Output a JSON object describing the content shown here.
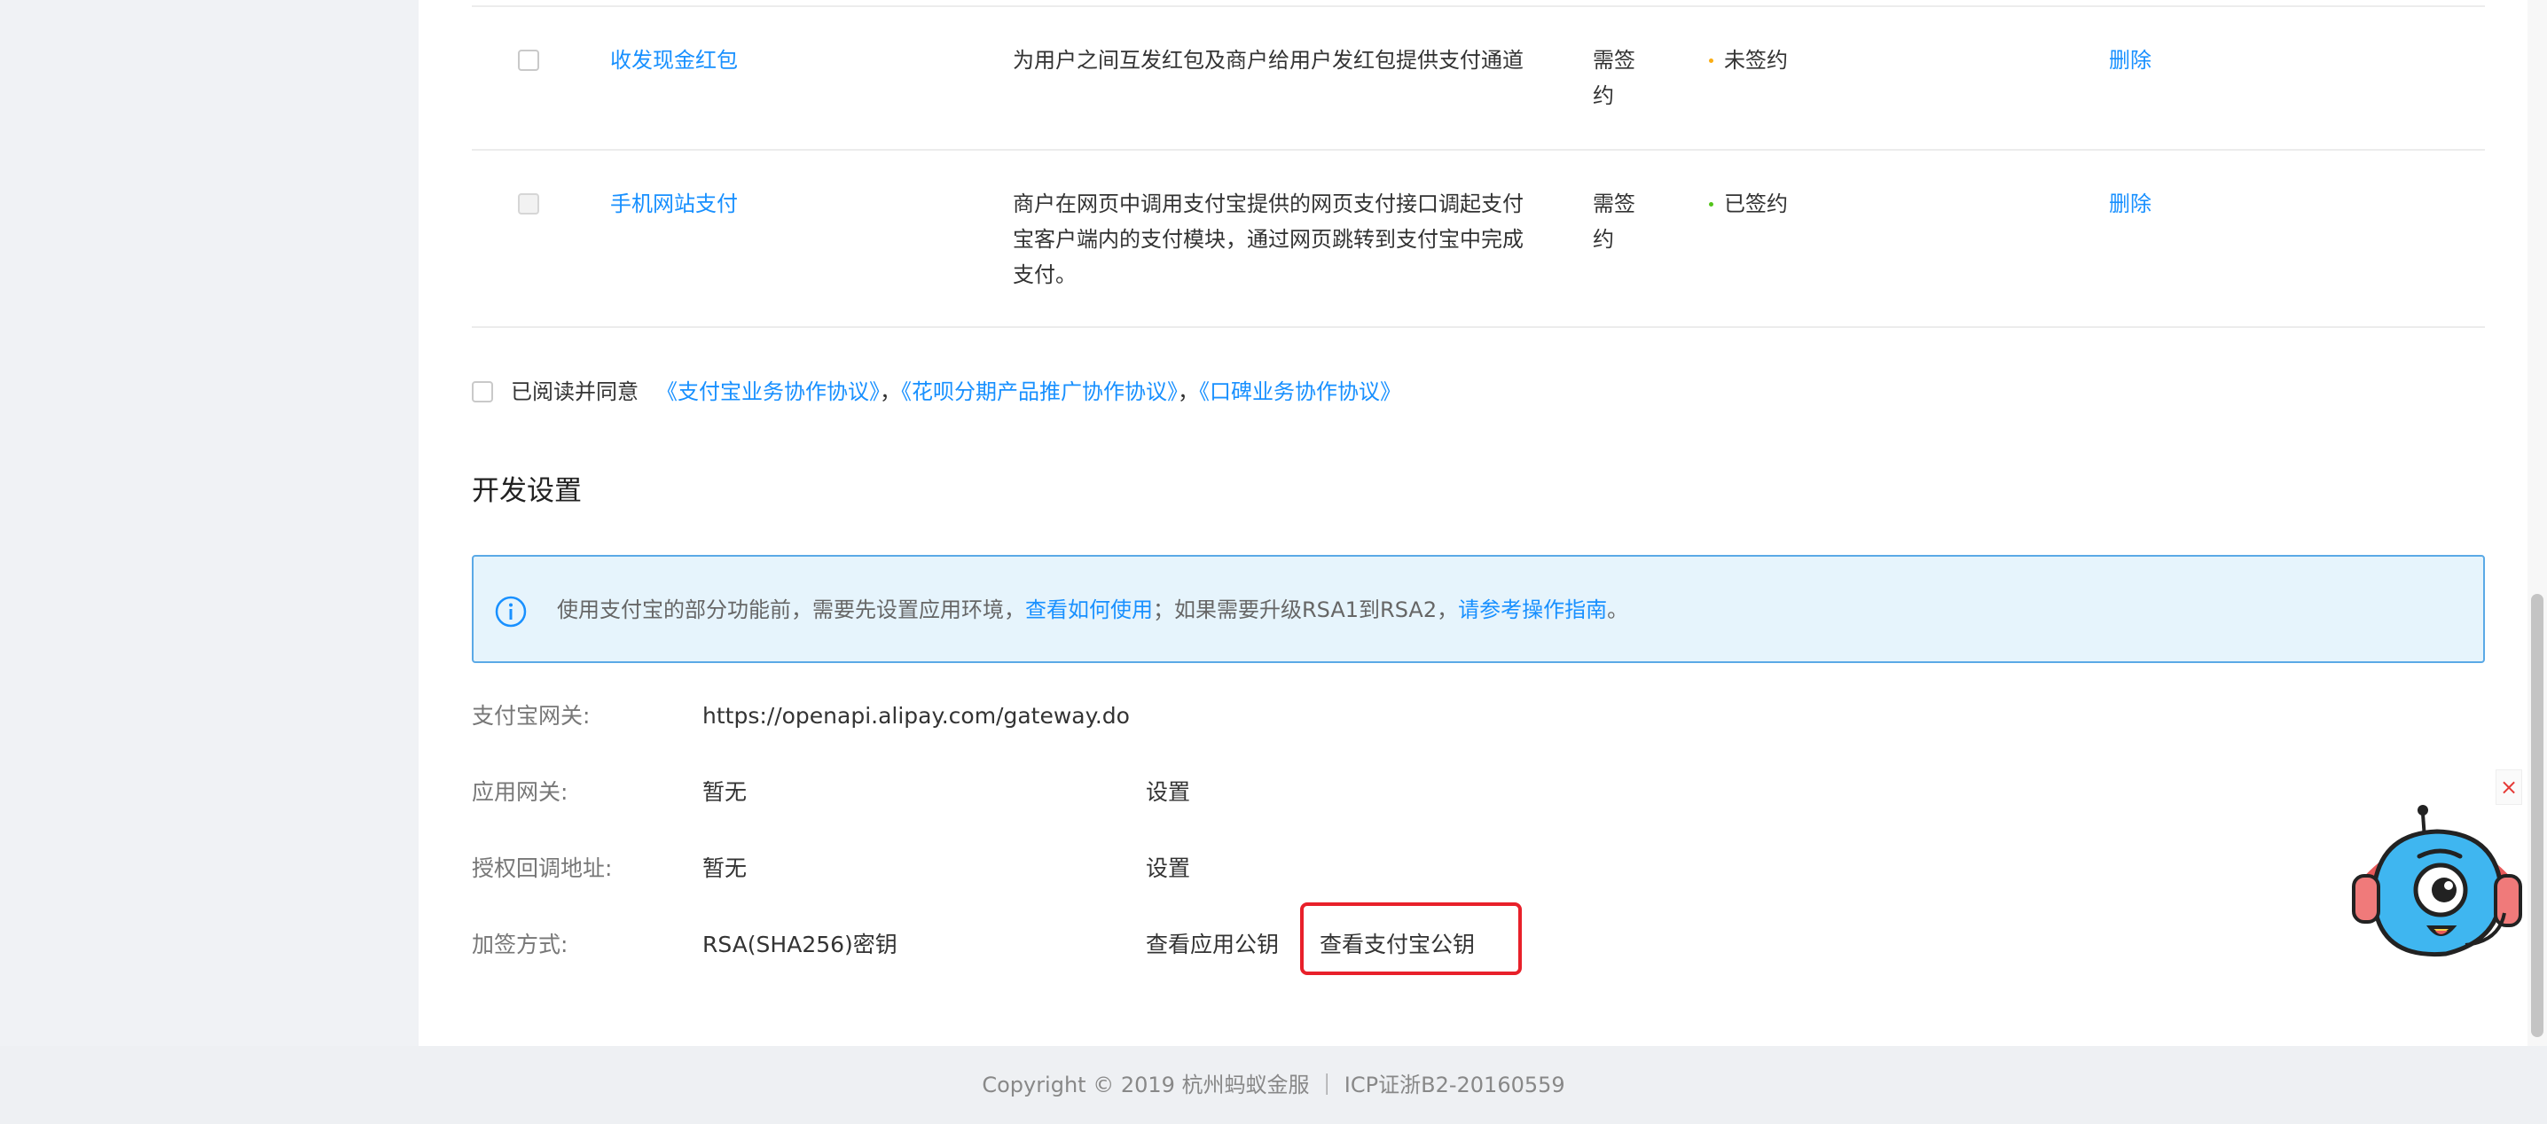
{
  "products": {
    "rows": [
      {
        "name": "收发现金红包",
        "desc_lines": [
          "为用户之间互发红包及商户给用户发红包提供支付通道"
        ],
        "sign_req_lines": [
          "需签",
          "约"
        ],
        "status": "未签约",
        "status_color": "#faad14",
        "action": "删除"
      },
      {
        "name": "手机网站支付",
        "desc_lines": [
          "商户在网页中调用支付宝提供的网页支付接口调起支付",
          "宝客户端内的支付模块，通过网页跳转到支付宝中完成",
          "支付。"
        ],
        "sign_req_lines": [
          "需签",
          "约"
        ],
        "status": "已签约",
        "status_color": "#52c41a",
        "action": "删除"
      }
    ]
  },
  "agreement": {
    "prefix": "已阅读并同意",
    "link1": "《支付宝业务协作协议》",
    "sep1": "，",
    "link2": "《花呗分期产品推广协作协议》",
    "sep2": "，",
    "link3": "《口碑业务协作协议》"
  },
  "dev_settings": {
    "title": "开发设置",
    "alert": {
      "text1": "使用支付宝的部分功能前，需要先设置应用环境，",
      "link1": "查看如何使用",
      "text2": "；如果需要升级RSA1到RSA2，",
      "link2": "请参考操作指南",
      "text3": "。"
    },
    "fields": [
      {
        "label": "支付宝网关:",
        "value": "https://openapi.alipay.com/gateway.do"
      },
      {
        "label": "应用网关:",
        "value": "暂无",
        "action": "设置"
      },
      {
        "label": "授权回调地址:",
        "value": "暂无",
        "action": "设置"
      },
      {
        "label": "加签方式:",
        "value": "RSA(SHA256)密钥",
        "action": "查看应用公钥",
        "action2": "查看支付宝公钥"
      }
    ]
  },
  "footer": {
    "text": "Copyright © 2019 杭州蚂蚁金服 ｜ ICP证浙B2-20160559"
  },
  "widget": {
    "close_glyph": "×"
  },
  "icons": {
    "info": "info-circle-icon",
    "close": "close-icon",
    "mascot": "support-mascot-icon"
  },
  "colors": {
    "link": "#1890ff",
    "highlight": "#e8202a",
    "alert_bg": "#e6f4fc",
    "alert_border": "#5aa9e6"
  }
}
